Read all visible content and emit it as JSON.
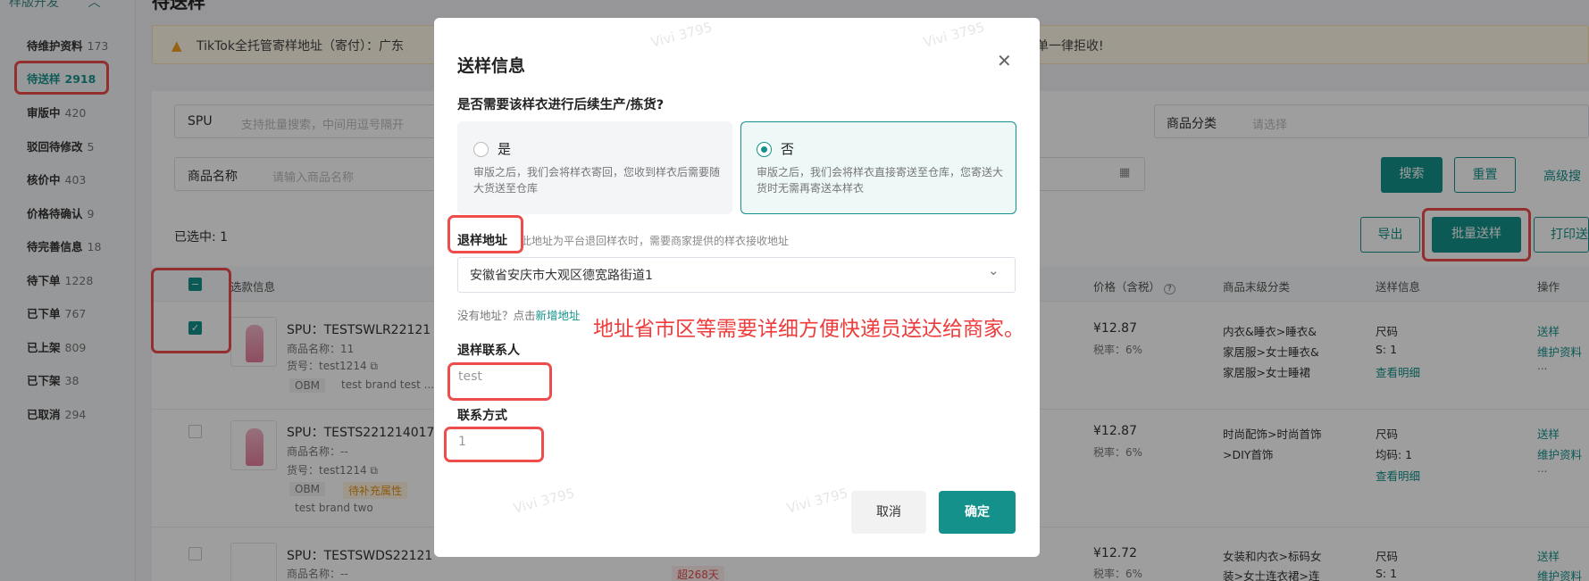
{
  "sidebar": {
    "group": "样版开发",
    "items": [
      {
        "label": "待维护资料",
        "count": "173"
      },
      {
        "label": "待送样",
        "count": "2918"
      },
      {
        "label": "审版中",
        "count": "420"
      },
      {
        "label": "驳回待修改",
        "count": "5"
      },
      {
        "label": "核价中",
        "count": "403"
      },
      {
        "label": "价格待确认",
        "count": "9"
      },
      {
        "label": "待完善信息",
        "count": "18"
      },
      {
        "label": "待下单",
        "count": "1228"
      },
      {
        "label": "已下单",
        "count": "767"
      },
      {
        "label": "已上架",
        "count": "809"
      },
      {
        "label": "已下架",
        "count": "38"
      },
      {
        "label": "已取消",
        "count": "294"
      }
    ]
  },
  "page": {
    "title": "待送样",
    "alert_left": "TikTok全托管寄样地址（寄付）：广东",
    "alert_right": "单一律拒收!"
  },
  "filters": {
    "spu_label": "SPU",
    "spu_placeholder": "支持批量搜索，中间用逗号隔开",
    "name_label": "商品名称",
    "name_placeholder": "请输入商品名称",
    "category_label": "商品分类",
    "category_placeholder": "请选择",
    "search_btn": "搜索",
    "reset_btn": "重置",
    "advanced": "高级搜"
  },
  "actions": {
    "selected": "已选中: 1",
    "export": "导出",
    "batch_send": "批量送样",
    "print": "打印送"
  },
  "table": {
    "headers": [
      "选款信息",
      "价格（含税）",
      "商品末级分类",
      "送样信息",
      "操作"
    ],
    "rows": [
      {
        "spu": "SPU：TESTSWLR22121",
        "name": "商品名称：11",
        "sku": "货号：test1214",
        "tags": [
          "OBM",
          "test brand test ..."
        ],
        "price": "¥12.87",
        "tax": "税率：6%",
        "category": [
          "内衣&睡衣>睡衣&",
          "家居服>女士睡衣&",
          "家居服>女士睡裙"
        ],
        "sample": [
          "尺码",
          "S: 1"
        ],
        "detail": "查看明细",
        "ops": [
          "送样",
          "维护资料",
          "..."
        ]
      },
      {
        "spu": "SPU：TESTS221214017",
        "name": "商品名称：--",
        "sku": "货号：test1214",
        "tags": [
          "OBM",
          "待补充属性"
        ],
        "brand": "test brand two",
        "price": "¥12.87",
        "tax": "税率：6%",
        "category": [
          "时尚配饰>时尚首饰",
          ">DIY首饰"
        ],
        "sample": [
          "尺码",
          "均码: 1"
        ],
        "detail": "查看明细",
        "ops": [
          "送样",
          "维护资料",
          "..."
        ]
      },
      {
        "spu": "SPU：TESTSWDS22121",
        "name": "商品名称：--",
        "badge": "超268天",
        "price": "¥12.72",
        "tax": "税率：6%",
        "category": [
          "女装和内衣>标码女",
          "装>女士连衣裙>连"
        ],
        "sample": [
          "尺码",
          "S: 1"
        ],
        "ops": [
          "送样",
          "维护资料"
        ]
      }
    ]
  },
  "modal": {
    "title": "送样信息",
    "question": "是否需要该样衣进行后续生产/拣货?",
    "option_yes": {
      "title": "是",
      "desc": "审版之后，我们会将样衣寄回，您收到样衣后需要随大货送至仓库"
    },
    "option_no": {
      "title": "否",
      "desc": "审版之后，我们会将样衣直接寄送至仓库，您寄送大货时无需再寄送本样衣"
    },
    "return_addr_label": "退样地址",
    "return_addr_hint": "此地址为平台退回样衣时，需要商家提供的样衣接收地址",
    "address": "安徽省安庆市大观区德宽路街道1",
    "no_addr": "没有地址？点击",
    "new_addr": "新增地址",
    "contact_label": "退样联系人",
    "contact_value": "test",
    "phone_label": "联系方式",
    "phone_value": "1",
    "cancel": "取消",
    "confirm": "确定"
  },
  "annotation": "地址省市区等需要详细方便快递员送达给商家。",
  "watermark": "Vivi 3795",
  "colors": {
    "accent": "#14918b",
    "highlight": "#ee4d4d"
  }
}
